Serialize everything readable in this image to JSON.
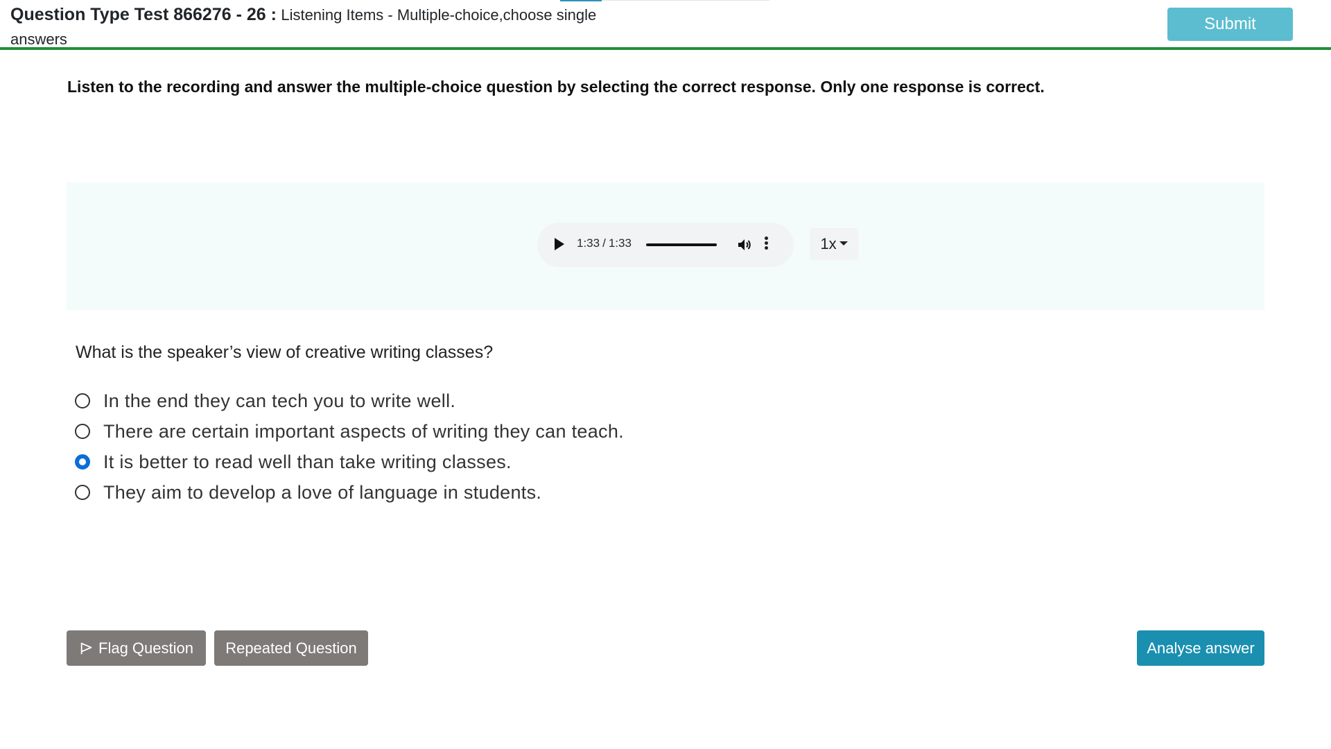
{
  "header": {
    "title_main": "Question Type Test 866276 - 26 :",
    "title_sub": "Listening Items - Multiple-choice,choose single answers",
    "submit_label": "Submit"
  },
  "instructions": "Listen to the recording and answer the multiple-choice question by selecting the correct response. Only one response is correct.",
  "audio": {
    "current_time": "1:33",
    "duration": "1:33",
    "progress": 1.0,
    "speed_label": "1x"
  },
  "question": {
    "text": "What is the speaker’s view of creative writing classes?",
    "options": [
      {
        "label": "In the end they can tech you to write well.",
        "checked": false
      },
      {
        "label": "There are certain important aspects of writing they can teach.",
        "checked": false
      },
      {
        "label": "It is better to read well than take writing classes.",
        "checked": true
      },
      {
        "label": "They aim to develop a love of language in students.",
        "checked": false
      }
    ]
  },
  "footer": {
    "flag_label": "Flag Question",
    "repeat_label": "Repeated Question",
    "analyse_label": "Analyse answer"
  },
  "colors": {
    "header_border": "#1f8f3a",
    "submit_bg": "#5bbdcf",
    "analyse_bg": "#1a8fb0",
    "secondary_btn_bg": "#7d7a78",
    "radio_checked": "#0b6ed8",
    "audio_panel_bg": "#f4fbfb"
  }
}
